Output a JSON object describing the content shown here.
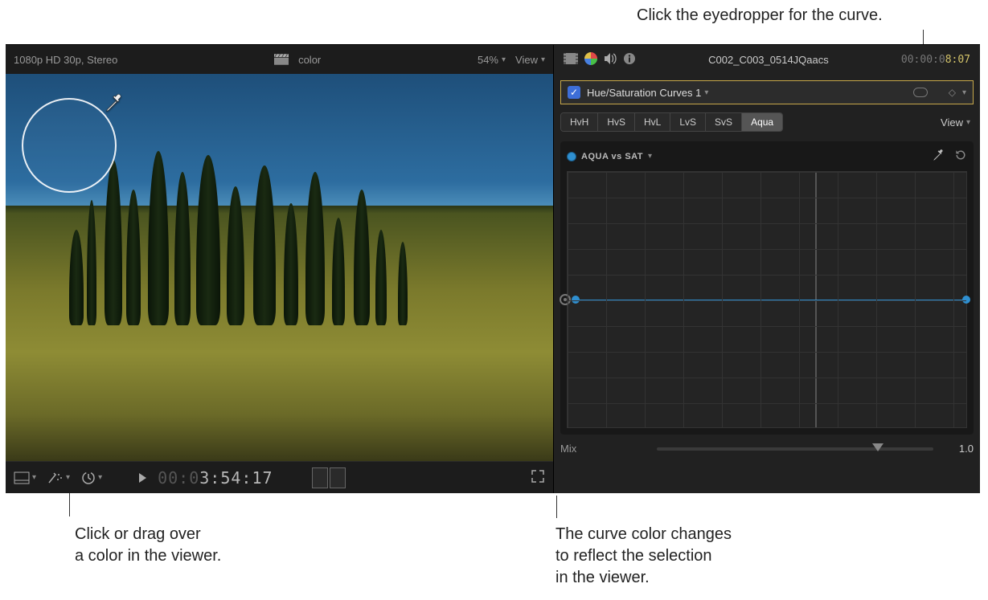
{
  "annotations": {
    "a1": "Click the eyedropper for the curve.",
    "a2_l1": "Click or drag over",
    "a2_l2": "a color in the viewer.",
    "a3_l1": "The curve color changes",
    "a3_l2": "to reflect the selection",
    "a3_l3": "in the viewer."
  },
  "viewer": {
    "format": "1080p HD 30p, Stereo",
    "clip": "color",
    "zoom": "54%",
    "view": "View",
    "timecode_dim": "00:0",
    "timecode": "3:54:17"
  },
  "inspector": {
    "clipname": "C002_C003_0514JQaacs",
    "tc_dim": "00:00:0",
    "tc_hl": "8:07",
    "effect_name": "Hue/Saturation Curves 1",
    "tabs": [
      "HvH",
      "HvS",
      "HvL",
      "LvS",
      "SvS",
      "Aqua"
    ],
    "active_tab": "Aqua",
    "view": "View",
    "curve_title": "AQUA vs SAT",
    "mix_label": "Mix",
    "mix_value": "1.0"
  }
}
